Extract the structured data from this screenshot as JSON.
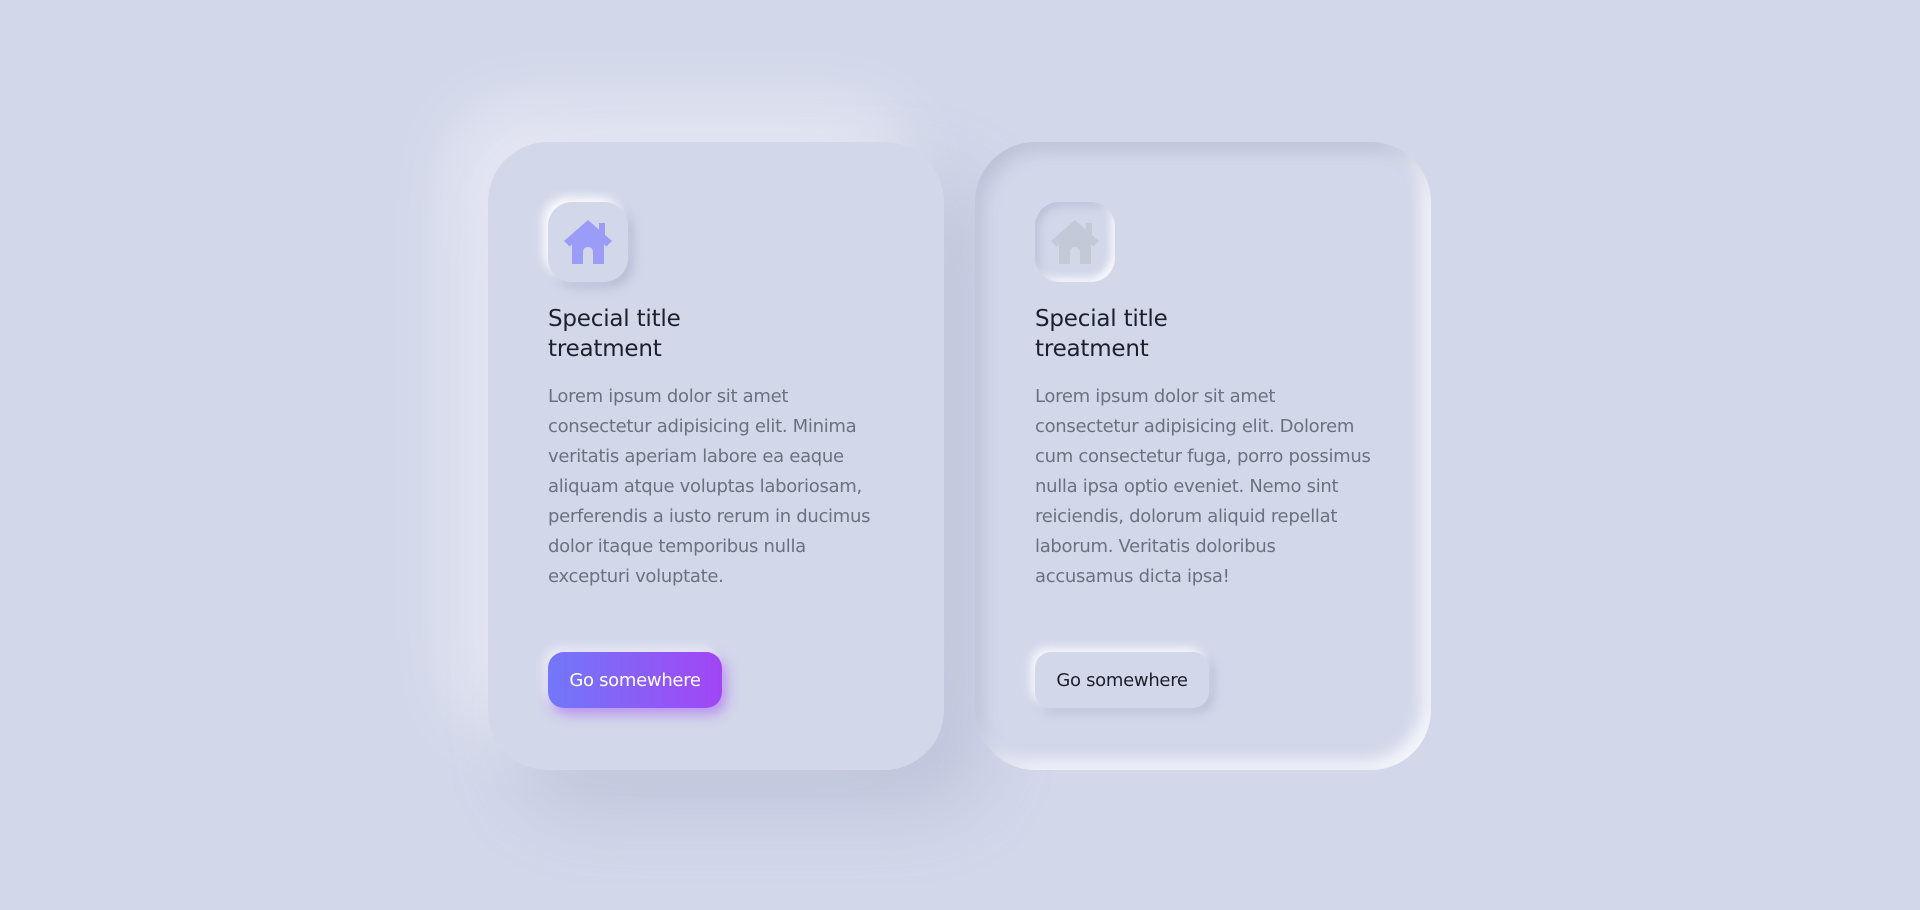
{
  "cards": [
    {
      "icon": "home-icon",
      "title_line1": "Special title",
      "title_line2": "treatment",
      "body": "Lorem ipsum dolor sit amet consectetur adipisicing elit. Minima veritatis aperiam labore ea eaque aliquam atque voluptas laboriosam, perferendis a iusto rerum in ducimus dolor itaque temporibus nulla excepturi voluptate.",
      "button_label": "Go somewhere",
      "icon_color": "#9a9cf8",
      "button_gradient": [
        "#7278f8",
        "#a146f5"
      ]
    },
    {
      "icon": "home-icon",
      "title_line1": "Special title",
      "title_line2": "treatment",
      "body": "Lorem ipsum dolor sit amet consectetur adipisicing elit. Dolorem cum consectetur fuga, porro possimus nulla ipsa optio eveniet. Nemo sint reiciendis, dolorum aliquid repellat laborum. Veritatis doloribus accusamus dicta ipsa!",
      "button_label": "Go somewhere",
      "icon_color": "#c2c9d7"
    }
  ],
  "colors": {
    "background": "#d2d7ea",
    "title": "#1d1f2b",
    "body_text": "#6c7180"
  }
}
